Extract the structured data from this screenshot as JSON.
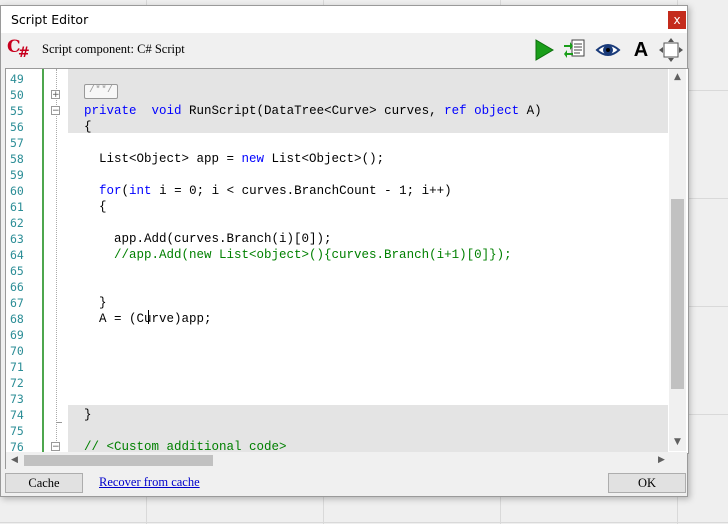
{
  "window": {
    "title": "Script Editor",
    "close_glyph": "x"
  },
  "toolbar": {
    "language_icon": "csharp-icon",
    "component_label": "Script component: C# Script",
    "buttons": [
      {
        "name": "run-icon",
        "color": "#1a9e1a"
      },
      {
        "name": "export-icon",
        "color": "#555555"
      },
      {
        "name": "eye-icon",
        "color": "#1a3b7a"
      },
      {
        "name": "font-icon",
        "label": "A"
      },
      {
        "name": "resize-icon",
        "color": "#555555"
      }
    ]
  },
  "editor": {
    "line_numbers": [
      "49",
      "50",
      "55",
      "56",
      "57",
      "58",
      "59",
      "60",
      "61",
      "62",
      "63",
      "64",
      "65",
      "66",
      "67",
      "68",
      "69",
      "70",
      "71",
      "72",
      "73",
      "74",
      "75",
      "76"
    ],
    "region_label": "/**/",
    "lines": [
      {
        "n": "49",
        "text": ""
      },
      {
        "n": "50",
        "text": ""
      },
      {
        "n": "55",
        "parts": [
          [
            "kw",
            "private"
          ],
          [
            "",
            "  "
          ],
          [
            "kw",
            "void"
          ],
          [
            "",
            " RunScript(DataTree<Curve> curves, "
          ],
          [
            "kw",
            "ref"
          ],
          [
            "",
            " "
          ],
          [
            "kw",
            "object"
          ],
          [
            "",
            " A)"
          ]
        ]
      },
      {
        "n": "56",
        "text": "{"
      },
      {
        "n": "57",
        "text": ""
      },
      {
        "n": "58",
        "parts": [
          [
            "",
            "  List<Object> app = "
          ],
          [
            "kw",
            "new"
          ],
          [
            "",
            " List<Object>();"
          ]
        ]
      },
      {
        "n": "59",
        "text": ""
      },
      {
        "n": "60",
        "parts": [
          [
            "",
            "  "
          ],
          [
            "kw",
            "for"
          ],
          [
            "",
            "("
          ],
          [
            "kw",
            "int"
          ],
          [
            "",
            " i = 0; i < curves.BranchCount - 1; i++)"
          ]
        ]
      },
      {
        "n": "61",
        "text": "  {"
      },
      {
        "n": "62",
        "text": ""
      },
      {
        "n": "63",
        "text": "    app.Add(curves.Branch(i)[0]);"
      },
      {
        "n": "64",
        "parts": [
          [
            "",
            "    "
          ],
          [
            "cm",
            "//app.Add(new List<object>(){curves.Branch(i+1)[0]});"
          ]
        ]
      },
      {
        "n": "65",
        "text": ""
      },
      {
        "n": "66",
        "text": ""
      },
      {
        "n": "67",
        "text": "  }"
      },
      {
        "n": "68",
        "text": "  A = (Curve)app;"
      },
      {
        "n": "69",
        "text": ""
      },
      {
        "n": "70",
        "text": ""
      },
      {
        "n": "71",
        "text": ""
      },
      {
        "n": "72",
        "text": ""
      },
      {
        "n": "73",
        "text": ""
      },
      {
        "n": "74",
        "text": "}"
      },
      {
        "n": "75",
        "text": ""
      },
      {
        "n": "76",
        "parts": [
          [
            "cm",
            "// <Custom additional code>"
          ]
        ]
      }
    ]
  },
  "footer": {
    "cache_button": "Cache",
    "recover_link": "Recover from cache",
    "ok_button": "OK"
  }
}
